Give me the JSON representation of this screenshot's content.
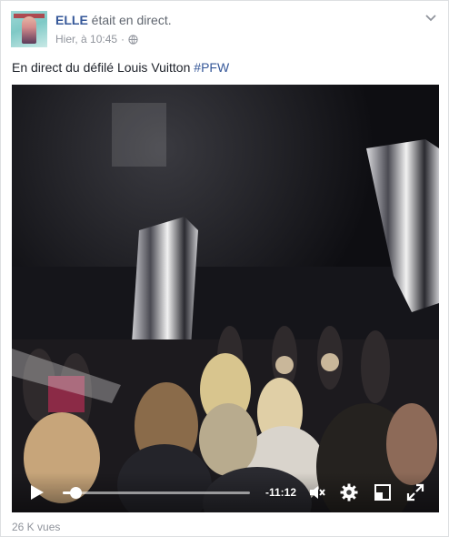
{
  "post": {
    "page_name": "ELLE",
    "live_status": "était en direct.",
    "timestamp": "Hier, à 10:45",
    "separator": "·",
    "privacy_icon": "globe-icon",
    "text": "En direct du défilé Louis Vuitton",
    "hashtag": "#PFW",
    "menu_icon": "chevron-down-icon"
  },
  "video": {
    "remaining_time": "-11:12",
    "progress_fraction": 0.07,
    "controls": [
      "play-icon",
      "mute-icon",
      "settings-icon",
      "pip-icon",
      "fullscreen-icon"
    ]
  },
  "footer": {
    "views": "26 K vues"
  },
  "colors": {
    "link": "#365899",
    "text": "#1d2129",
    "muted": "#90949c",
    "video_bg": "#0f0f12"
  }
}
